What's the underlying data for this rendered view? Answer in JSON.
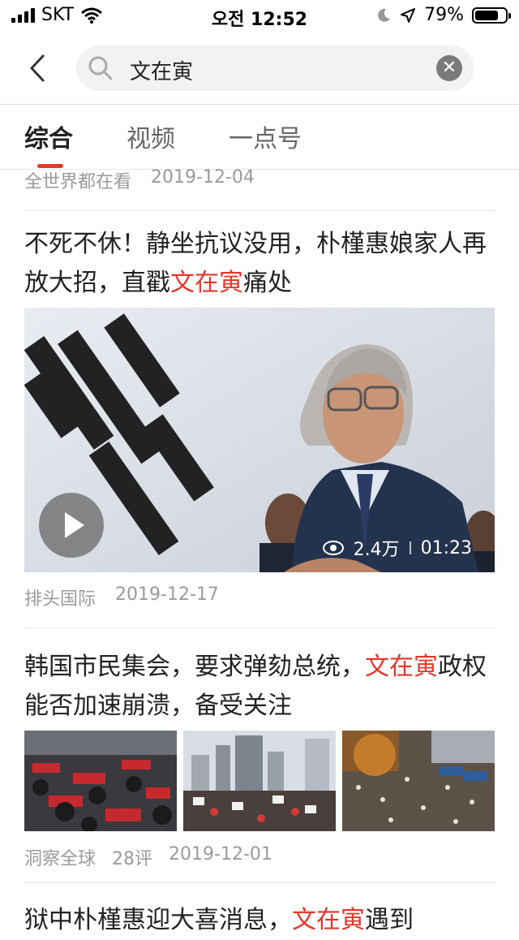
{
  "status_bar": {
    "carrier": "SKT",
    "time": "오전 12:52",
    "battery": "79%",
    "battery_level": 0.79
  },
  "search": {
    "query": "文在寅",
    "back_icon": "chevron-left-icon",
    "search_icon": "search-icon",
    "clear_icon": "clear-icon"
  },
  "tabs": [
    {
      "label": "综合",
      "active": true
    },
    {
      "label": "视频"
    },
    {
      "label": "一点号"
    }
  ],
  "top_item": {
    "source": "全世界都在看",
    "date": "2019-12-04"
  },
  "articles": [
    {
      "title_pre": "不死不休！静坐抗议没用，朴槿惠娘家人再放大招，直戳",
      "title_hl": "文在寅",
      "title_post": "痛处",
      "views": "2.4万",
      "duration": "01:23",
      "source": "排头国际",
      "date": "2019-12-17"
    },
    {
      "title_pre": "韩国市民集会，要求弹劾总统，",
      "title_hl": "文在寅",
      "title_post": "政权能否加速崩溃，备受关注",
      "source": "洞察全球",
      "comments": "28评",
      "date": "2019-12-01"
    },
    {
      "title_pre": "狱中朴槿惠迎大喜消息，",
      "title_hl": "文在寅",
      "title_post": "遇到"
    }
  ],
  "colors": {
    "accent": "#e8352c",
    "meta_text": "#9a9a9a"
  }
}
